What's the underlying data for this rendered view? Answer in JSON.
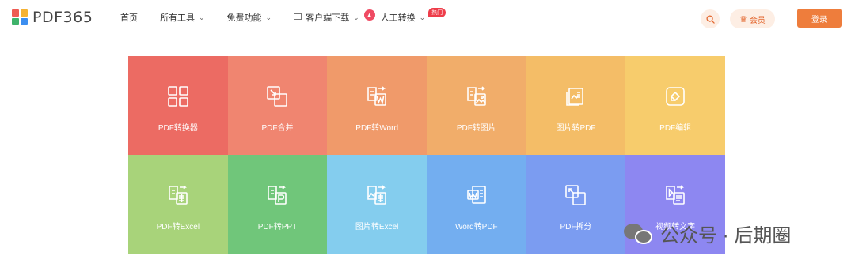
{
  "brand": {
    "logo_text": "PDF365"
  },
  "nav": {
    "home": "首页",
    "all_tools": "所有工具",
    "free": "免费功能",
    "download": "客户端下载",
    "manual": "人工转换",
    "hot_badge": "热门"
  },
  "header": {
    "vip_label": "会员",
    "login_label": "登录"
  },
  "tools": [
    {
      "label": "PDF转换器",
      "color": "#ec6b63"
    },
    {
      "label": "PDF合并",
      "color": "#f08570"
    },
    {
      "label": "PDF转Word",
      "color": "#f09a6a"
    },
    {
      "label": "PDF转图片",
      "color": "#f1ad6a"
    },
    {
      "label": "图片转PDF",
      "color": "#f4bd67"
    },
    {
      "label": "PDF编辑",
      "color": "#f7cc6c"
    },
    {
      "label": "PDF转Excel",
      "color": "#a8d37a"
    },
    {
      "label": "PDF转PPT",
      "color": "#70c67a"
    },
    {
      "label": "图片转Excel",
      "color": "#84cdee"
    },
    {
      "label": "Word转PDF",
      "color": "#73aef0"
    },
    {
      "label": "PDF拆分",
      "color": "#7b9cf1"
    },
    {
      "label": "视频转文字",
      "color": "#8d87f1"
    }
  ],
  "watermark": {
    "text": "公众号 · 后期圈"
  }
}
